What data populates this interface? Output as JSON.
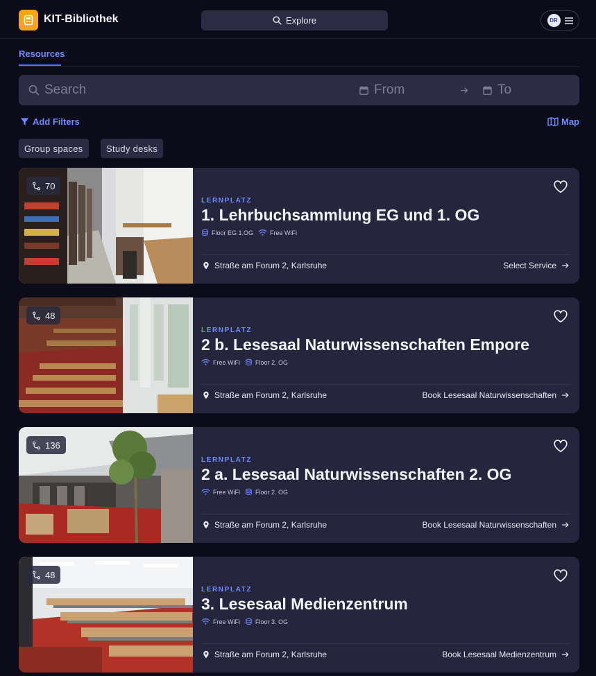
{
  "app": {
    "title": "KIT-Bibliothek",
    "avatar_initials": "DR"
  },
  "header": {
    "explore_label": "Explore"
  },
  "tabs": [
    {
      "label": "Resources",
      "active": true
    }
  ],
  "search": {
    "placeholder": "Search",
    "from_label": "From",
    "to_label": "To"
  },
  "filters": {
    "add_label": "Add Filters",
    "map_label": "Map",
    "chips": [
      {
        "label": "Group spaces"
      },
      {
        "label": "Study desks"
      }
    ]
  },
  "colors": {
    "accent": "#6f8cff",
    "logo": "#f7a21b",
    "card_bg": "#25263d",
    "page_bg": "#0b0b1a"
  },
  "resources": [
    {
      "type": "LERNPLATZ",
      "capacity": "70",
      "title": "1. Lehrbuchsammlung EG und 1. OG",
      "tag1": "Floor EG 1.OG",
      "tag2": "Free WiFi",
      "address": "Straße am Forum 2, Karlsruhe",
      "action": "Select Service"
    },
    {
      "type": "LERNPLATZ",
      "capacity": "48",
      "title": "2 b. Lesesaal Naturwissenschaften Empore",
      "tag1": "Free WiFi",
      "tag2": "Floor 2. OG",
      "address": "Straße am Forum 2, Karlsruhe",
      "action": "Book Lesesaal Naturwissenschaften"
    },
    {
      "type": "LERNPLATZ",
      "capacity": "136",
      "title": "2 a. Lesesaal Naturwissenschaften 2. OG",
      "tag1": "Free WiFi",
      "tag2": "Floor 2. OG",
      "address": "Straße am Forum 2, Karlsruhe",
      "action": "Book Lesesaal Naturwissenschaften"
    },
    {
      "type": "LERNPLATZ",
      "capacity": "48",
      "title": "3. Lesesaal Medienzentrum",
      "tag1": "Free WiFi",
      "tag2": "Floor 3. OG",
      "address": "Straße am Forum 2, Karlsruhe",
      "action": "Book Lesesaal Medienzentrum"
    }
  ]
}
